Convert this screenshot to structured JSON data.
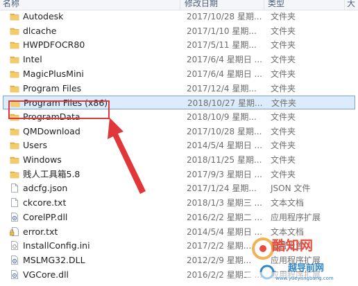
{
  "header": {
    "name": "名称",
    "date": "修改日期",
    "type": "类型",
    "size": "大"
  },
  "files": [
    {
      "name": "Autodesk",
      "date": "2017/10/28 星期...",
      "type": "文件夹",
      "icon": "folder-icon"
    },
    {
      "name": "dlcache",
      "date": "2017/1/10 星期...",
      "type": "文件夹",
      "icon": "folder-icon"
    },
    {
      "name": "HWPDFOCR80",
      "date": "2017/5/11 星期...",
      "type": "文件夹",
      "icon": "folder-icon"
    },
    {
      "name": "Intel",
      "date": "2017/6/4 星期日 ...",
      "type": "文件夹",
      "icon": "folder-icon"
    },
    {
      "name": "MagicPlusMini",
      "date": "2017/6/4 星期日 ...",
      "type": "文件夹",
      "icon": "folder-icon"
    },
    {
      "name": "Program Files",
      "date": "2017/12/4 星期...",
      "type": "文件夹",
      "icon": "folder-icon"
    },
    {
      "name": "Program Files (x86)",
      "date": "2018/10/27 星期...",
      "type": "文件夹",
      "icon": "folder-icon",
      "selected": true
    },
    {
      "name": "ProgramData",
      "date": "2018/10/9 星期...",
      "type": "文件夹",
      "icon": "folder-icon"
    },
    {
      "name": "QMDownload",
      "date": "2017/10/28 星期...",
      "type": "文件夹",
      "icon": "folder-icon"
    },
    {
      "name": "Users",
      "date": "2014/5/4 星期日 ...",
      "type": "文件夹",
      "icon": "folder-icon"
    },
    {
      "name": "Windows",
      "date": "2018/11/25 星期...",
      "type": "文件夹",
      "icon": "folder-icon"
    },
    {
      "name": "贱人工具箱5.8",
      "date": "2017/9/3 星期日 ...",
      "type": "文件夹",
      "icon": "folder-icon"
    },
    {
      "name": "adcfg.json",
      "date": "2017/1/24 星期...",
      "type": "JSON 文件",
      "icon": "file-icon"
    },
    {
      "name": "ckcore.txt",
      "date": "2018/1/3 星期三 ...",
      "type": "文本文档",
      "icon": "file-icon"
    },
    {
      "name": "CorelPP.dll",
      "date": "2016/2/2 星期二 ...",
      "type": "应用程序扩展",
      "icon": "dll-icon"
    },
    {
      "name": "error.txt",
      "date": "2014/5/4 星期日 ...",
      "type": "文本文档",
      "icon": "locked-file-icon"
    },
    {
      "name": "InstallConfig.ini",
      "date": "2017/2/2 星期...",
      "type": "配置设置",
      "icon": "ini-icon"
    },
    {
      "name": "MSLMG32.DLL",
      "date": "2012/2/9 星期...",
      "type": "应用程序扩展",
      "icon": "dll-icon"
    },
    {
      "name": "VGCore.dll",
      "date": "2016/2/2 星期二 ...",
      "type": "应用程序扩展",
      "icon": "dll-icon"
    }
  ],
  "watermark": {
    "brand": "酷知网",
    "slogan": "越导前网",
    "url": "www.yueyangbang.com"
  },
  "colors": {
    "folder": "#e8b84a",
    "selection": "#dcecfc",
    "highlight": "#e0383a",
    "arrow": "#e0383a"
  }
}
